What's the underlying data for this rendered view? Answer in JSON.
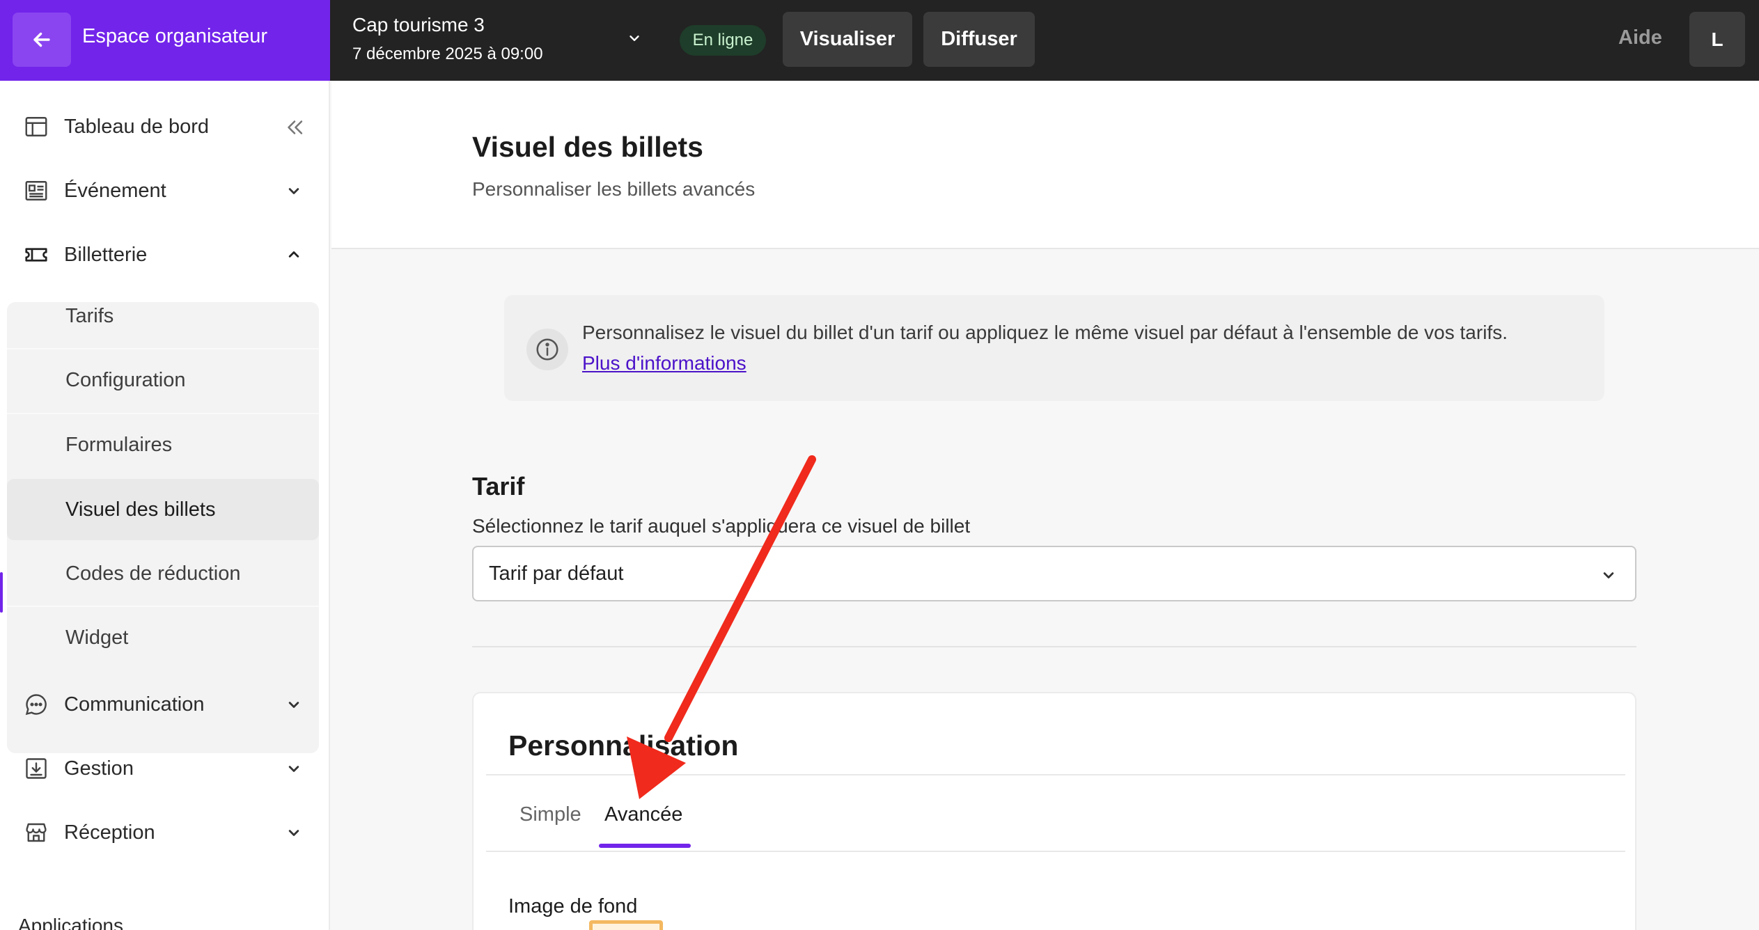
{
  "topbar": {
    "org_label": "Espace organisateur",
    "event_title": "Cap tourisme 3",
    "event_date": "7 décembre 2025 à 09:00",
    "status": "En ligne",
    "visualiser_label": "Visualiser",
    "diffuser_label": "Diffuser",
    "help_label": "Aide",
    "avatar_initial": "L"
  },
  "sidebar": {
    "items": [
      {
        "label": "Tableau de bord",
        "icon": "layout-icon"
      },
      {
        "label": "Événement",
        "icon": "event-card-icon"
      },
      {
        "label": "Billetterie",
        "icon": "ticket-icon"
      }
    ],
    "billetterie_sub": [
      {
        "label": "Tarifs"
      },
      {
        "label": "Configuration"
      },
      {
        "label": "Formulaires"
      },
      {
        "label": "Visuel des billets"
      },
      {
        "label": "Codes de réduction"
      },
      {
        "label": "Widget"
      }
    ],
    "bottom_items": [
      {
        "label": "Communication",
        "icon": "chat-icon"
      },
      {
        "label": "Gestion",
        "icon": "download-box-icon"
      },
      {
        "label": "Réception",
        "icon": "store-icon"
      }
    ],
    "apps_label": "Applications"
  },
  "header": {
    "title": "Visuel des billets",
    "subtitle": "Personnaliser les billets avancés"
  },
  "info": {
    "text": "Personnalisez le visuel du billet d'un tarif ou appliquez le même visuel par défaut à l'ensemble de vos tarifs.",
    "link": "Plus d'informations"
  },
  "tarif": {
    "title": "Tarif",
    "description": "Sélectionnez le tarif auquel s'appliquera ce visuel de billet",
    "selected": "Tarif par défaut"
  },
  "personnalisation": {
    "title": "Personnalisation",
    "tabs": [
      "Simple",
      "Avancée"
    ],
    "active_tab": "Avancée",
    "bg_label": "Image de fond"
  },
  "colors": {
    "brand": "#7224ea",
    "topbar": "#232323",
    "annotation_arrow": "#f02a1c"
  }
}
